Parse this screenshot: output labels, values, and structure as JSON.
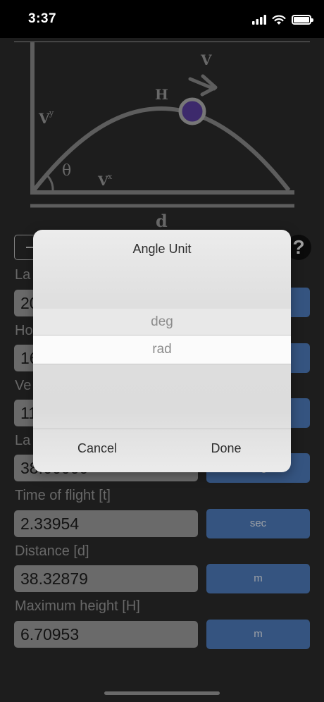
{
  "status_bar": {
    "time": "3:37"
  },
  "diagram": {
    "label_v": "V",
    "label_h": "H",
    "label_vy": "V",
    "label_vy_sup": "y",
    "label_theta": "θ",
    "label_vx": "V",
    "label_vx_sup": "x",
    "label_d": "d"
  },
  "help": {
    "label": "?"
  },
  "fields": [
    {
      "label": "La",
      "value": "20",
      "unit": ""
    },
    {
      "label": "Ho",
      "value": "16",
      "unit": ""
    },
    {
      "label": "Ve",
      "value": "11",
      "unit": ""
    },
    {
      "label": "La",
      "value": "38.66666",
      "unit": "deg"
    },
    {
      "label": "Time of flight [t]",
      "value": "2.33954",
      "unit": "sec"
    },
    {
      "label": "Distance [d]",
      "value": "38.32879",
      "unit": "m"
    },
    {
      "label": "Maximum height [H]",
      "value": "6.70953",
      "unit": "m"
    }
  ],
  "picker": {
    "title": "Angle Unit",
    "options": [
      "deg",
      "rad"
    ],
    "selected": "rad",
    "cancel_label": "Cancel",
    "done_label": "Done"
  },
  "colors": {
    "accent": "#4f7dbd",
    "ball": "#5b3fa0",
    "background": "#2b2b2b"
  }
}
